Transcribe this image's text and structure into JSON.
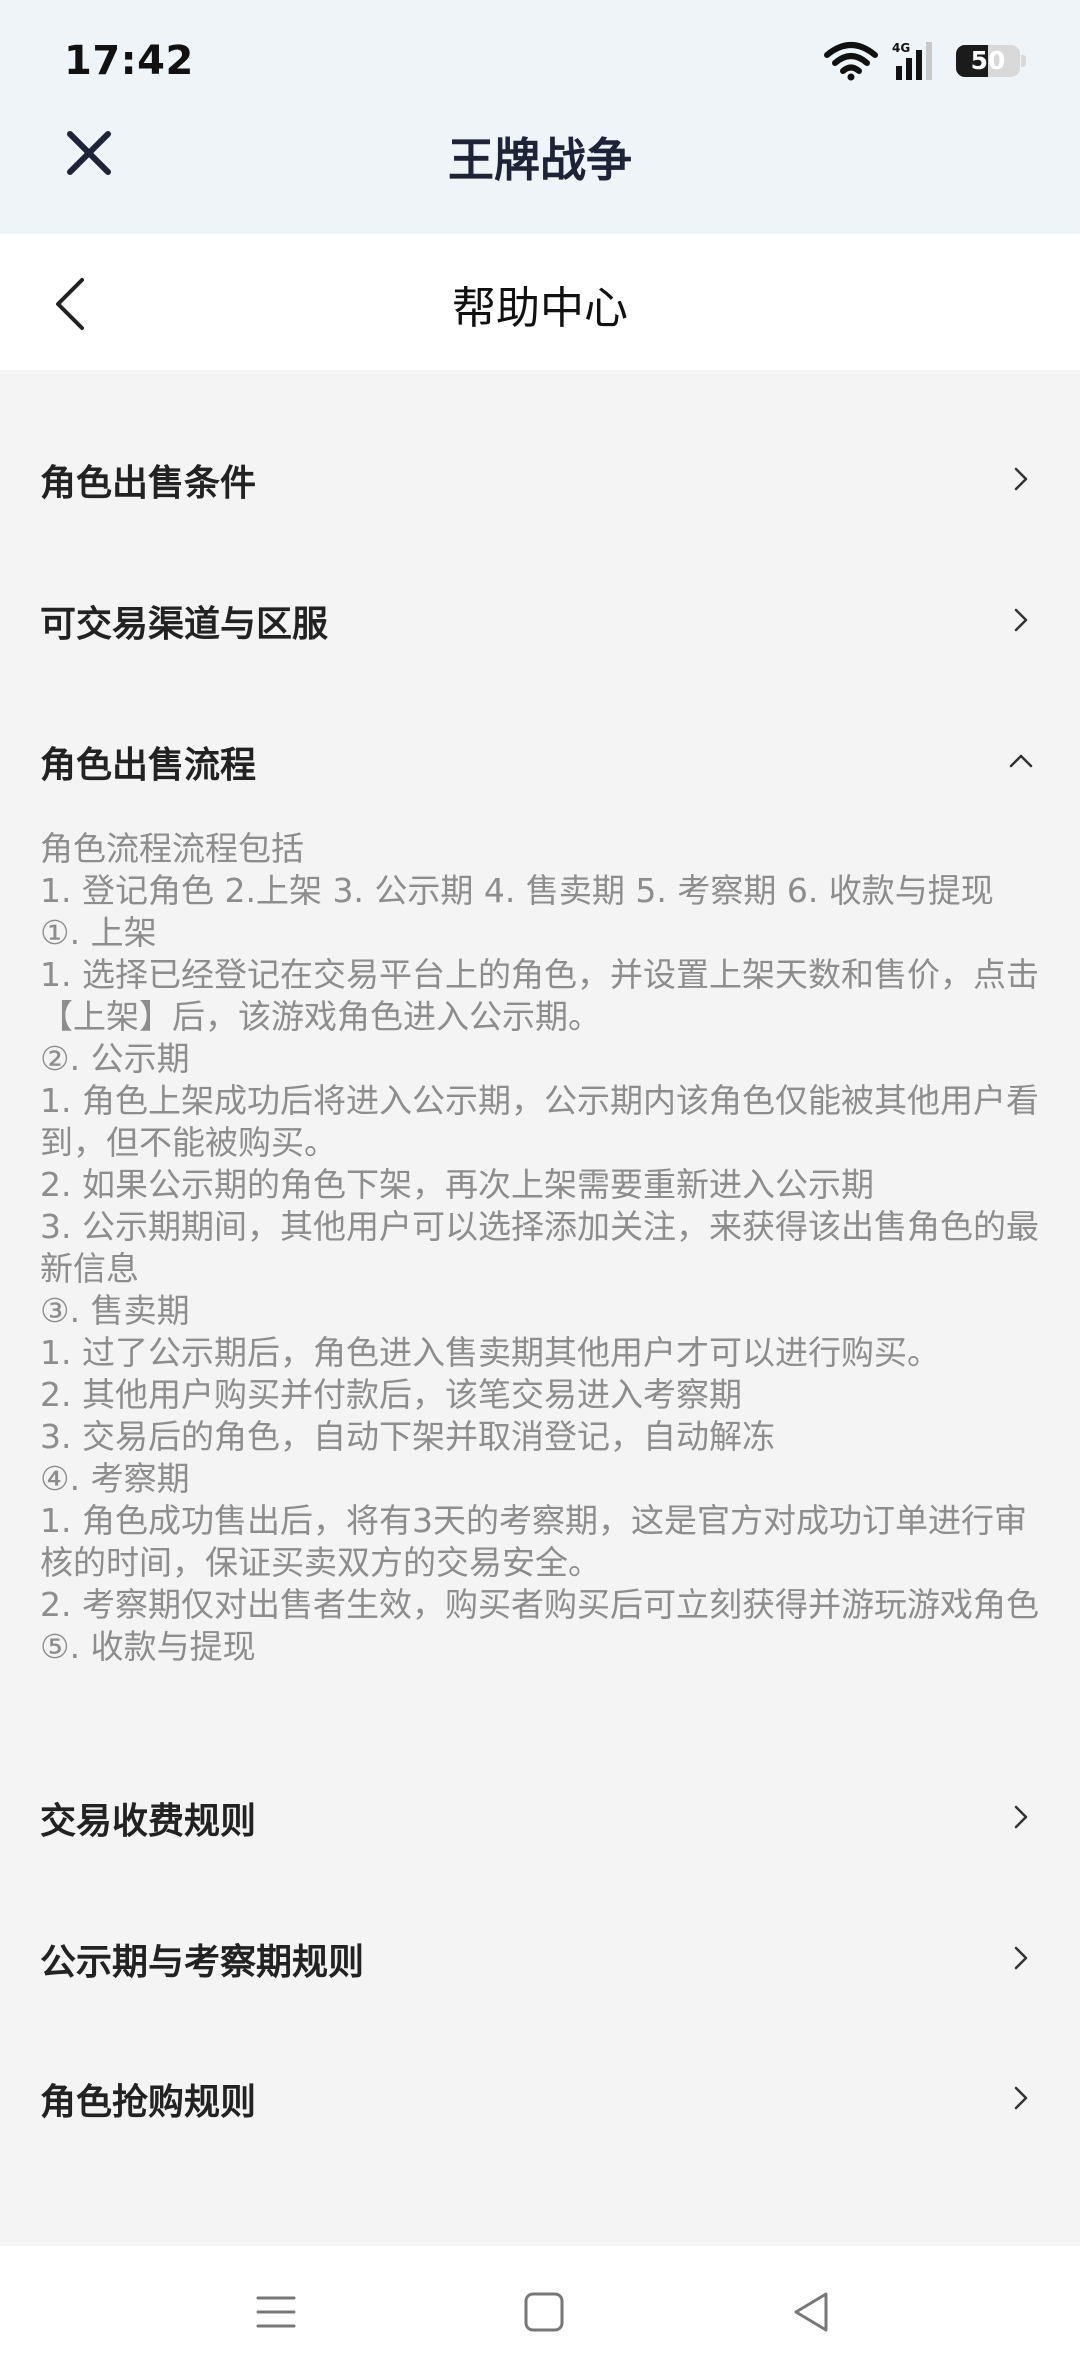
{
  "status_bar": {
    "time": "17:42",
    "network": "4G",
    "battery": "50",
    "battery_level": 0.5,
    "icons": [
      "wifi-icon",
      "cellular-signal-icon",
      "battery-icon"
    ]
  },
  "app_bar": {
    "title": "王牌战争",
    "close_icon": "close-icon"
  },
  "page_header": {
    "title": "帮助中心",
    "back_icon": "chevron-left-icon"
  },
  "sections": [
    {
      "label": "角色出售条件",
      "expanded": false
    },
    {
      "label": "可交易渠道与区服",
      "expanded": false
    },
    {
      "label": "角色出售流程",
      "expanded": true
    },
    {
      "label": "交易收费规则",
      "expanded": false
    },
    {
      "label": "公示期与考察期规则",
      "expanded": false
    },
    {
      "label": "角色抢购规则",
      "expanded": false
    }
  ],
  "expanded_detail": {
    "lines": [
      "角色流程流程包括",
      "1. 登记角色 2.上架 3. 公示期 4. 售卖期 5. 考察期 6. 收款与提现",
      "①. 上架",
      "1. 选择已经登记在交易平台上的角色，并设置上架天数和售价，点击【上架】后，该游戏角色进入公示期。",
      "②. 公示期",
      "1. 角色上架成功后将进入公示期，公示期内该角色仅能被其他用户看到，但不能被购买。",
      "2. 如果公示期的角色下架，再次上架需要重新进入公示期",
      "3. 公示期期间，其他用户可以选择添加关注，来获得该出售角色的最新信息",
      "③. 售卖期",
      "1. 过了公示期后，角色进入售卖期其他用户才可以进行购买。",
      "2. 其他用户购买并付款后，该笔交易进入考察期",
      "3. 交易后的角色，自动下架并取消登记，自动解冻",
      "④. 考察期",
      "1. 角色成功售出后，将有3天的考察期，这是官方对成功订单进行审核的时间，保证买卖双方的交易安全。",
      "2. 考察期仅对出售者生效，购买者购买后可立刻获得并游玩游戏角色",
      "⑤. 收款与提现"
    ]
  },
  "nav_bar": {
    "icons": [
      "menu-icon",
      "home-icon",
      "back-icon"
    ]
  },
  "colors": {
    "top_bg": "#eef4f7",
    "page_bg": "#f4f4f4",
    "title": "#1e2338",
    "detail_text": "#8d8d8d"
  }
}
